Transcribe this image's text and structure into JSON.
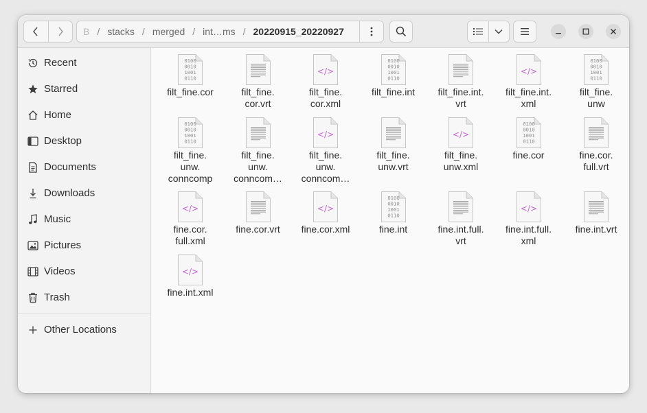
{
  "header": {
    "path": {
      "hidden_prefix": "B",
      "segments": [
        "stacks",
        "merged",
        "int…ms"
      ],
      "current": "20220915_20220927"
    }
  },
  "sidebar": {
    "items": [
      {
        "label": "Recent",
        "icon": "clock-icon"
      },
      {
        "label": "Starred",
        "icon": "star-icon"
      },
      {
        "label": "Home",
        "icon": "home-icon"
      },
      {
        "label": "Desktop",
        "icon": "desktop-icon"
      },
      {
        "label": "Documents",
        "icon": "document-icon"
      },
      {
        "label": "Downloads",
        "icon": "download-icon"
      },
      {
        "label": "Music",
        "icon": "music-icon"
      },
      {
        "label": "Pictures",
        "icon": "picture-icon"
      },
      {
        "label": "Videos",
        "icon": "video-icon"
      },
      {
        "label": "Trash",
        "icon": "trash-icon"
      }
    ],
    "other_locations": "Other Locations"
  },
  "files": [
    {
      "lines": [
        "filt_fine.cor"
      ],
      "type": "binary"
    },
    {
      "lines": [
        "filt_fine.",
        "cor.vrt"
      ],
      "type": "text"
    },
    {
      "lines": [
        "filt_fine.",
        "cor.xml"
      ],
      "type": "xml"
    },
    {
      "lines": [
        "filt_fine.int"
      ],
      "type": "binary"
    },
    {
      "lines": [
        "filt_fine.int.",
        "vrt"
      ],
      "type": "text"
    },
    {
      "lines": [
        "filt_fine.int.",
        "xml"
      ],
      "type": "xml"
    },
    {
      "lines": [
        "filt_fine.",
        "unw"
      ],
      "type": "binary"
    },
    {
      "lines": [
        "filt_fine.",
        "unw.",
        "conncomp"
      ],
      "type": "binary"
    },
    {
      "lines": [
        "filt_fine.",
        "unw.",
        "conncom…"
      ],
      "type": "text"
    },
    {
      "lines": [
        "filt_fine.",
        "unw.",
        "conncom…"
      ],
      "type": "xml"
    },
    {
      "lines": [
        "filt_fine.",
        "unw.vrt"
      ],
      "type": "text"
    },
    {
      "lines": [
        "filt_fine.",
        "unw.xml"
      ],
      "type": "xml"
    },
    {
      "lines": [
        "fine.cor"
      ],
      "type": "binary"
    },
    {
      "lines": [
        "fine.cor.",
        "full.vrt"
      ],
      "type": "text"
    },
    {
      "lines": [
        "fine.cor.",
        "full.xml"
      ],
      "type": "xml"
    },
    {
      "lines": [
        "fine.cor.vrt"
      ],
      "type": "text"
    },
    {
      "lines": [
        "fine.cor.xml"
      ],
      "type": "xml"
    },
    {
      "lines": [
        "fine.int"
      ],
      "type": "binary"
    },
    {
      "lines": [
        "fine.int.full.",
        "vrt"
      ],
      "type": "text"
    },
    {
      "lines": [
        "fine.int.full.",
        "xml"
      ],
      "type": "xml"
    },
    {
      "lines": [
        "fine.int.vrt"
      ],
      "type": "text"
    },
    {
      "lines": [
        "fine.int.xml"
      ],
      "type": "xml"
    }
  ],
  "binary_icon_text": [
    "0100",
    "0010",
    "1001",
    "0110"
  ],
  "xml_icon_text": "</>",
  "colors": {
    "xml_accent": "#c562d6",
    "binary_text": "#8e8e8e"
  }
}
